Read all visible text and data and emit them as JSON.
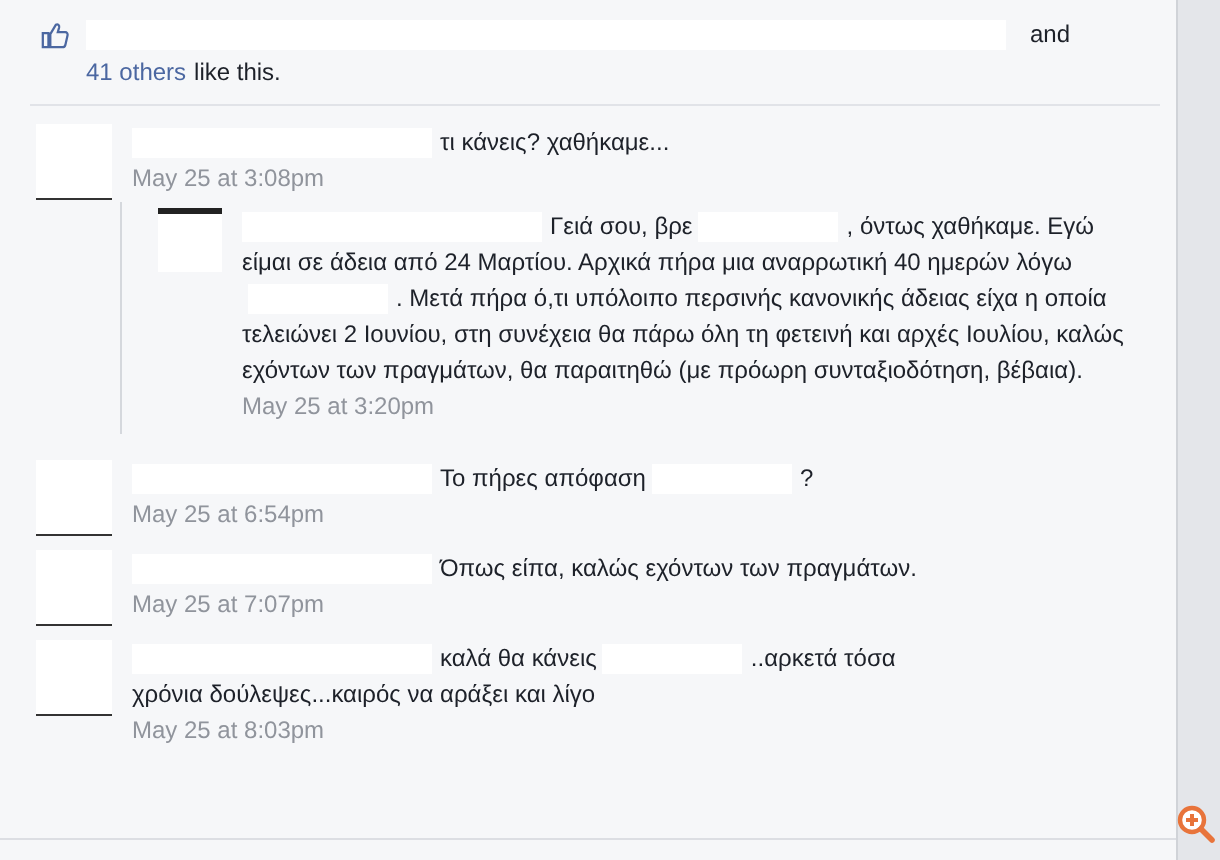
{
  "likes": {
    "line": [
      {
        "kind": "redacted"
      },
      {
        "kind": "text",
        "text": "and"
      }
    ],
    "others_link": "41 others",
    "suffix": "like this."
  },
  "comments": [
    {
      "segments": [
        {
          "kind": "redacted"
        },
        {
          "kind": "text",
          "text": "τι κάνεις? χαθήκαμε..."
        }
      ],
      "time": "May 25 at 3:08pm",
      "replies": [
        {
          "segments": [
            {
              "kind": "redacted"
            },
            {
              "kind": "text",
              "text": "Γειά σου, βρε"
            },
            {
              "kind": "redacted"
            },
            {
              "kind": "text",
              "text": ", όντως χαθήκαμε. Εγώ είμαι σε άδεια από 24 Μαρτίου. Αρχικά πήρα μια αναρρωτική 40 ημερών λόγω"
            },
            {
              "kind": "redacted"
            },
            {
              "kind": "text",
              "text": ". Μετά πήρα ό,τι υπόλοιπο περσινής κανονικής άδειας είχα η οποία τελειώνει 2 Ιουνίου, στη συνέχεια θα πάρω όλη τη φετεινή και αρχές Ιουλίου, καλώς εχόντων των πραγμάτων, θα παραιτηθώ (με πρόωρη συνταξιοδότηση, βέβαια)."
            }
          ],
          "time": "May 25 at 3:20pm"
        }
      ]
    },
    {
      "segments": [
        {
          "kind": "redacted"
        },
        {
          "kind": "text",
          "text": "Το πήρες απόφαση"
        },
        {
          "kind": "redacted"
        },
        {
          "kind": "text",
          "text": "?"
        }
      ],
      "time": "May 25 at 6:54pm"
    },
    {
      "segments": [
        {
          "kind": "redacted"
        },
        {
          "kind": "text",
          "text": "Όπως είπα, καλώς εχόντων των πραγμάτων."
        }
      ],
      "time": "May 25 at 7:07pm"
    },
    {
      "segments": [
        {
          "kind": "redacted"
        },
        {
          "kind": "text",
          "text": "καλά θα κάνεις"
        },
        {
          "kind": "redacted"
        },
        {
          "kind": "text",
          "text": "..αρκετά τόσα χρόνια δούλεψες...καιρός να αράξει και λίγο"
        }
      ],
      "time": "May 25 at 8:03pm"
    }
  ]
}
